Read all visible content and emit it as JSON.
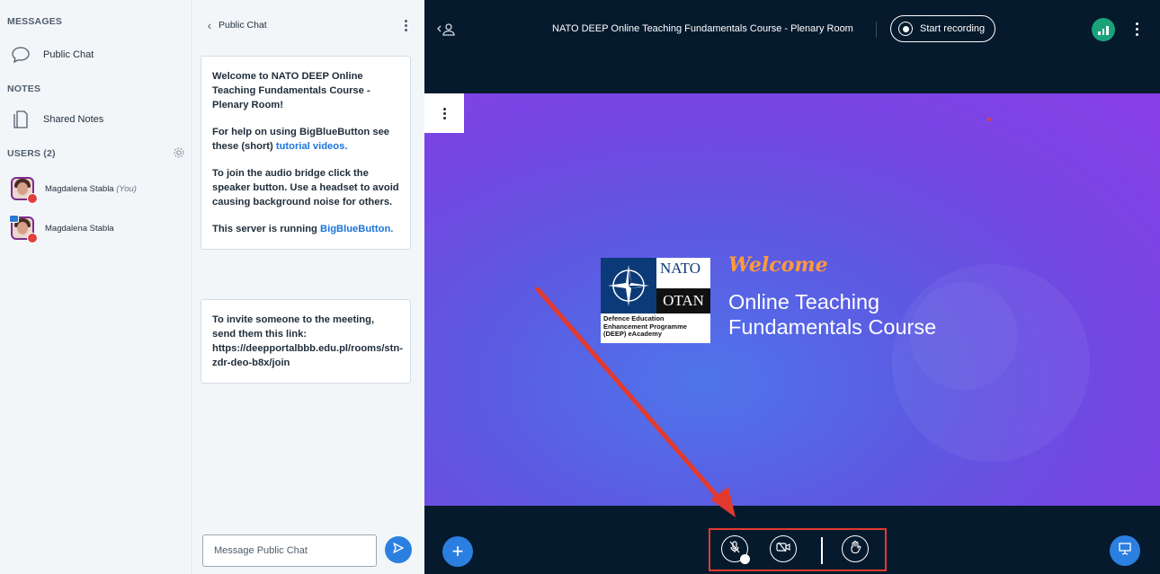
{
  "sidebar": {
    "messages_title": "MESSAGES",
    "public_chat_label": "Public Chat",
    "notes_title": "NOTES",
    "shared_notes_label": "Shared Notes",
    "users_title": "USERS (2)",
    "users": [
      {
        "name": "Magdalena Stabla",
        "suffix": "(You)"
      },
      {
        "name": "Magdalena Stabla",
        "suffix": ""
      }
    ]
  },
  "chat": {
    "title": "Public Chat",
    "welcome_intro": "Welcome to NATO DEEP Online Teaching Fundamentals Course - Plenary Room!",
    "help_text": "For help on using BigBlueButton see these (short)",
    "help_link": "tutorial videos.",
    "audio_text": "To join the audio bridge click the speaker button. Use a headset to avoid causing background noise for others.",
    "server_text": "This server is running",
    "server_link": "BigBlueButton.",
    "invite_text": "To invite someone to the meeting, send them this link: https://deepportalbbb.edu.pl/rooms/stn-zdr-deo-b8x/join",
    "input_placeholder": "Message Public Chat"
  },
  "meeting": {
    "title": "NATO DEEP Online Teaching Fundamentals Course - Plenary Room",
    "record_label": "Start recording"
  },
  "slide": {
    "nato_word": "NATO",
    "otan_word": "OTAN",
    "deep_text": "Defence Education Enhancement Programme (DEEP) eAcademy",
    "welcome": "Welcome",
    "course_line1": "Online Teaching",
    "course_line2": "Fundamentals Course"
  },
  "colors": {
    "accent": "#2b7fe0",
    "highlight": "#e23a2e",
    "dark_bg": "#061a2d",
    "connection": "#1aa37a"
  },
  "icons": {
    "public_chat": "chat-bubble-icon",
    "shared_notes": "document-icon",
    "users_settings": "gear-icon",
    "mute": "microphone-muted-icon",
    "video": "video-off-icon",
    "raise_hand": "hand-icon",
    "actions": "plus-icon",
    "presentation": "presentation-icon",
    "send": "send-icon"
  }
}
